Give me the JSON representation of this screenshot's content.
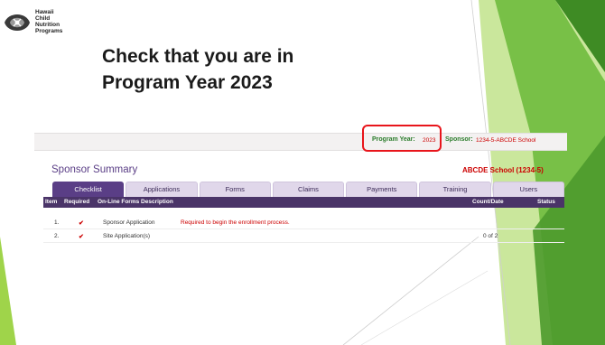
{
  "logo": {
    "lines": [
      "Hawaii",
      "Child",
      "Nutrition",
      "Programs"
    ]
  },
  "headline": {
    "line1": "Check that you are in",
    "line2": "Program Year 2023"
  },
  "topbar": {
    "program_year_label": "Program Year:",
    "program_year_value": "2023",
    "sponsor_label": "Sponsor:",
    "sponsor_value": "1234-5-ABCDE School"
  },
  "summary": {
    "title": "Sponsor Summary",
    "school": "ABCDE School (1234-5)"
  },
  "tabs": [
    {
      "label": "Checklist",
      "active": true
    },
    {
      "label": "Applications",
      "active": false
    },
    {
      "label": "Forms",
      "active": false
    },
    {
      "label": "Claims",
      "active": false
    },
    {
      "label": "Payments",
      "active": false
    },
    {
      "label": "Training",
      "active": false
    },
    {
      "label": "Users",
      "active": false
    }
  ],
  "table": {
    "headers": {
      "item": "Item",
      "required": "Required",
      "description": "On-Line Forms Description",
      "count": "Count/Date",
      "status": "Status"
    },
    "rows": [
      {
        "item": "1.",
        "required": "✔",
        "description": "Sponsor Application",
        "note": "Required to begin the enrollment process.",
        "count": "",
        "status": ""
      },
      {
        "item": "2.",
        "required": "✔",
        "description": "Site Application(s)",
        "note": "",
        "count": "0 of 2",
        "status": ""
      }
    ]
  },
  "colors": {
    "accent_purple": "#5a3e86",
    "header_purple": "#4a3468",
    "alert_red": "#cc0000",
    "highlight_red": "#e8151b",
    "label_green": "#2c7d2c",
    "deco_green_light": "#9fd44a",
    "deco_green_dark": "#4d9a2c"
  }
}
